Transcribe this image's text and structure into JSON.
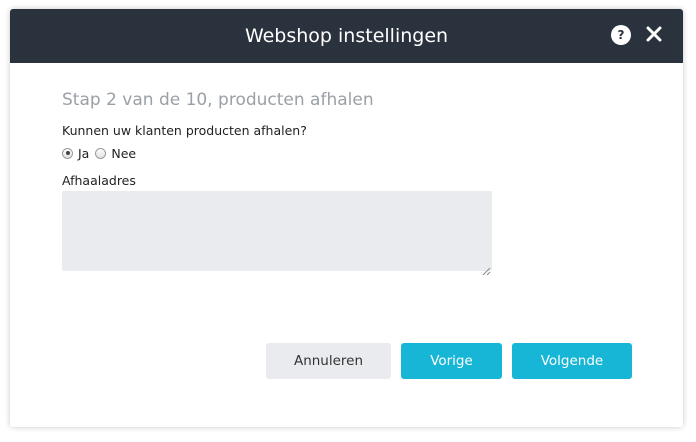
{
  "dialog": {
    "title": "Webshop instellingen",
    "help_glyph": "?",
    "icons": {
      "help": "help-icon",
      "close": "close-icon"
    }
  },
  "step": {
    "title": "Stap 2 van de 10, producten afhalen"
  },
  "pickup": {
    "question": "Kunnen uw klanten producten afhalen?",
    "options": [
      {
        "label": "Ja",
        "checked": true
      },
      {
        "label": "Nee",
        "checked": false
      }
    ]
  },
  "address": {
    "label": "Afhaaladres",
    "value": ""
  },
  "buttons": {
    "cancel": "Annuleren",
    "previous": "Vorige",
    "next": "Volgende"
  },
  "colors": {
    "header_bg": "#29323d",
    "accent": "#17b6d6",
    "muted_bg": "#e9ebee"
  }
}
